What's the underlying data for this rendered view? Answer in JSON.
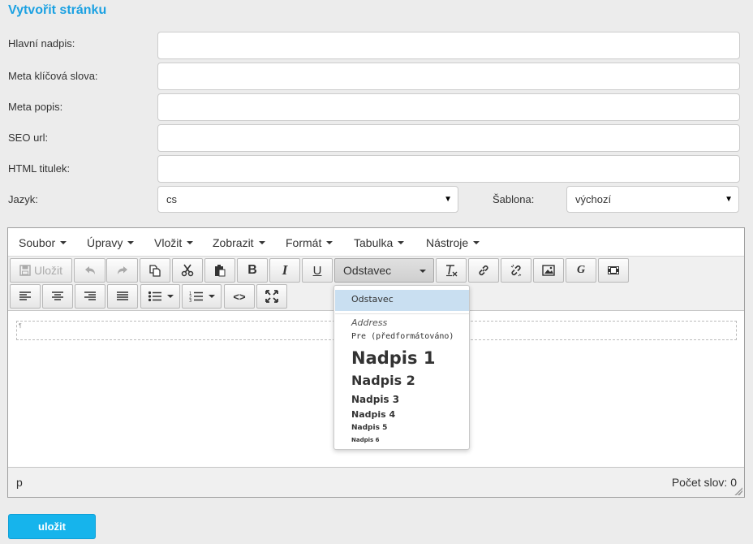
{
  "page": {
    "title": "Vytvořit stránku"
  },
  "form": {
    "fields": [
      {
        "label": "Hlavní nadpis:",
        "value": ""
      },
      {
        "label": "Meta klíčová slova:",
        "value": ""
      },
      {
        "label": "Meta popis:",
        "value": ""
      },
      {
        "label": "SEO url:",
        "value": ""
      },
      {
        "label": "HTML titulek:",
        "value": ""
      }
    ],
    "language": {
      "label": "Jazyk:",
      "value": "cs"
    },
    "template": {
      "label": "Šablona:",
      "value": "výchozí"
    }
  },
  "editor": {
    "menu": [
      "Soubor",
      "Úpravy",
      "Vložit",
      "Zobrazit",
      "Formát",
      "Tabulka",
      "Nástroje"
    ],
    "toolbar": {
      "save_label": "Uložit",
      "format_value": "Odstavec"
    },
    "format_options": [
      "Odstavec",
      "Address",
      "Pre (předformátováno)",
      "Nadpis 1",
      "Nadpis 2",
      "Nadpis 3",
      "Nadpis 4",
      "Nadpis 5",
      "Nadpis 6"
    ],
    "status": {
      "path": "p",
      "word_count": "Počet slov: 0"
    }
  },
  "actions": {
    "submit_label": "uložit"
  },
  "colors": {
    "accent": "#1ba1e2",
    "button": "#16b4ec",
    "selected": "#c9dff1"
  }
}
